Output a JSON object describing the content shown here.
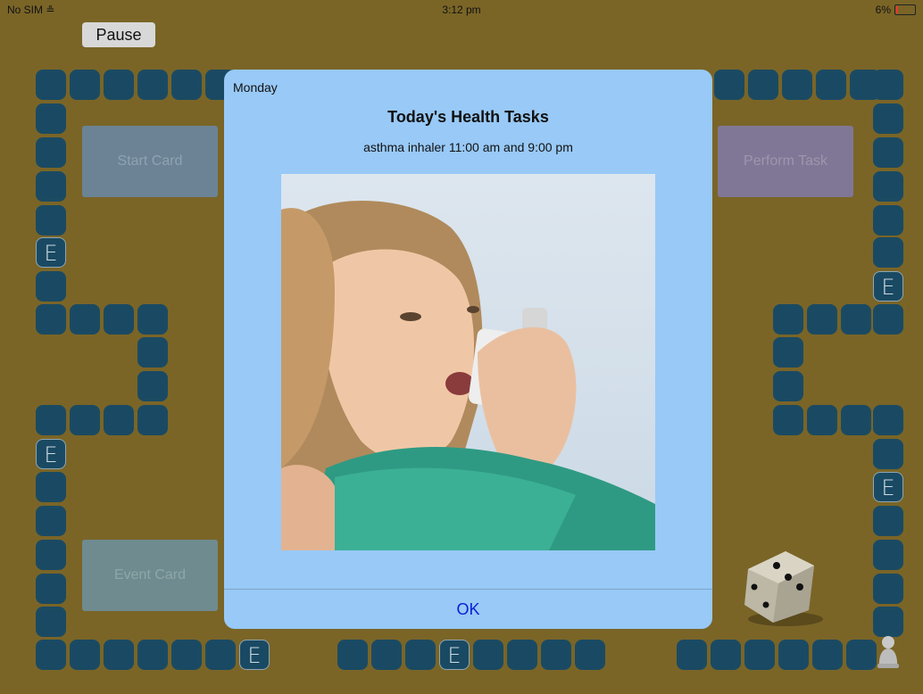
{
  "status_bar": {
    "carrier": "No SIM",
    "time": "3:12 pm",
    "battery": "6%",
    "battery_level": 0.06
  },
  "toolbar": {
    "pause_label": "Pause"
  },
  "board": {
    "start_card": "Start Card",
    "perform_task": "Perform Task",
    "event_card": "Event Card",
    "event_tile_label": "E",
    "dice_face": 3
  },
  "dialog": {
    "day": "Monday",
    "title": "Today's Health Tasks",
    "task": "asthma inhaler 11:00 am and 9:00 pm",
    "ok_label": "OK"
  },
  "colors": {
    "board": "#7a6527",
    "tile": "#1a4a63",
    "dialog": "#98c9f7",
    "ok_text": "#0a1fd4"
  }
}
